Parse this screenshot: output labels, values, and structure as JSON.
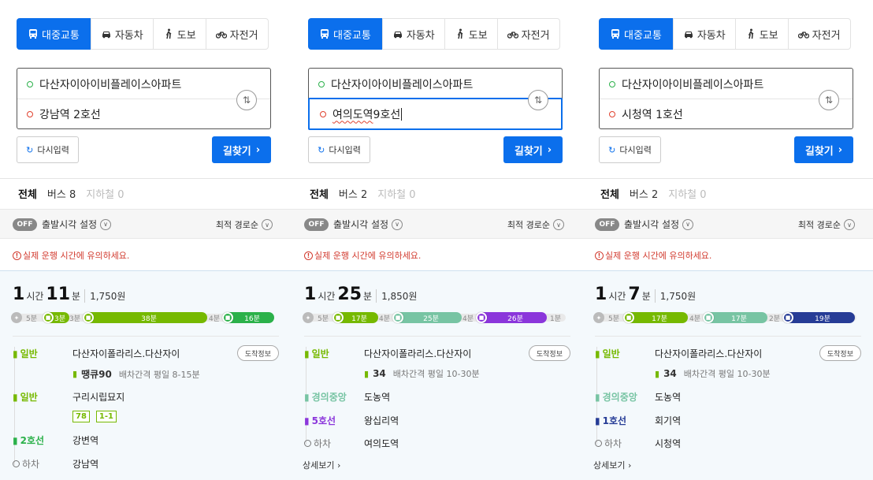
{
  "modes": [
    {
      "key": "transit",
      "label": "대중교통",
      "icon": "bus-icon"
    },
    {
      "key": "car",
      "label": "자동차",
      "icon": "car-icon"
    },
    {
      "key": "walk",
      "label": "도보",
      "icon": "walk-icon"
    },
    {
      "key": "bike",
      "label": "자전거",
      "icon": "bike-icon"
    }
  ],
  "common": {
    "reset_label": "다시입력",
    "find_label": "길찾기",
    "tab_all": "전체",
    "off_badge": "OFF",
    "departure_setting": "출발시각 설정",
    "sort": "최적 경로순",
    "warning": "실제 운행 시간에 유의하세요.",
    "hour_unit": "시간",
    "min_unit": "분",
    "arrival_info": "도착정보",
    "detail_link": "상세보기",
    "colors": {
      "primary": "#0b6fec",
      "bus_green": "#76b900",
      "subway_line2": "#2bb14a",
      "gyeongui": "#77c4a3",
      "line5": "#8b36db",
      "line1": "#263c96",
      "warning": "#d23b2f"
    }
  },
  "panels": [
    {
      "origin": "다산자이아이비플레이스아파트",
      "destination": "강남역 2호선",
      "tabs": {
        "bus": "버스 8",
        "subway": "지하철 0"
      },
      "summary": {
        "hours": "1",
        "minutes": "11",
        "fare": "1,750원"
      },
      "bar": {
        "walks": [
          "5분",
          "3분",
          "4분"
        ],
        "segments": [
          {
            "label": "3분",
            "color": "#76b900"
          },
          {
            "label": "38분",
            "color": "#76b900"
          },
          {
            "label": "16분",
            "color": "#2bb14a"
          }
        ]
      },
      "steps": [
        {
          "label": "일반",
          "station": "다산자이폴라리스.다산자이",
          "route": "땡큐90",
          "interval": "배차간격 평일 8-15분"
        },
        {
          "label": "일반",
          "station": "구리시립묘지",
          "chips": [
            "78",
            "1-1"
          ]
        },
        {
          "label": "2호선",
          "station": "강변역"
        },
        {
          "label": "하차",
          "station": "강남역"
        }
      ]
    },
    {
      "origin": "다산자이아이비플레이스아파트",
      "destination_typed": "여의도역",
      "destination_rest": " 9호선",
      "tabs": {
        "bus": "버스 2",
        "subway": "지하철 0"
      },
      "summary": {
        "hours": "1",
        "minutes": "25",
        "fare": "1,850원"
      },
      "bar": {
        "walks": [
          "5분",
          "4분",
          "4분",
          "1분"
        ],
        "segments": [
          {
            "label": "17분",
            "color": "#76b900"
          },
          {
            "label": "25분",
            "color": "#77c4a3"
          },
          {
            "label": "26분",
            "color": "#8b36db"
          }
        ]
      },
      "steps": [
        {
          "label": "일반",
          "station": "다산자이폴라리스.다산자이",
          "route": "34",
          "interval": "배차간격 평일 10-30분"
        },
        {
          "label": "경의중앙",
          "station": "도농역"
        },
        {
          "label": "5호선",
          "station": "왕십리역"
        },
        {
          "label": "하차",
          "station": "여의도역"
        }
      ]
    },
    {
      "origin": "다산자이아이비플레이스아파트",
      "destination": "시청역 1호선",
      "tabs": {
        "bus": "버스 2",
        "subway": "지하철 0"
      },
      "summary": {
        "hours": "1",
        "minutes": "7",
        "fare": "1,750원"
      },
      "bar": {
        "walks": [
          "5분",
          "4분",
          "2분"
        ],
        "segments": [
          {
            "label": "17분",
            "color": "#76b900"
          },
          {
            "label": "17분",
            "color": "#77c4a3"
          },
          {
            "label": "19분",
            "color": "#263c96"
          }
        ]
      },
      "steps": [
        {
          "label": "일반",
          "station": "다산자이폴라리스.다산자이",
          "route": "34",
          "interval": "배차간격 평일 10-30분"
        },
        {
          "label": "경의중앙",
          "station": "도농역"
        },
        {
          "label": "1호선",
          "station": "회기역"
        },
        {
          "label": "하차",
          "station": "시청역"
        }
      ]
    }
  ]
}
